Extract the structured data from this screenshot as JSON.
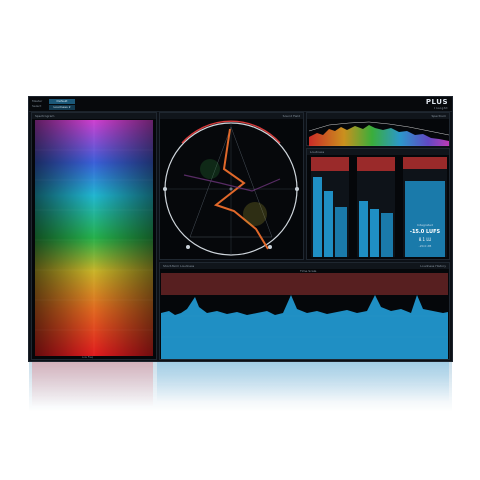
{
  "app": {
    "brand": "PLUS",
    "brand_sub": "Insight",
    "top_left_label_1": "Master",
    "top_left_label_2": "Select",
    "preset_button": "Default",
    "preset_sub": "Loudness 2"
  },
  "spectrogram": {
    "title": "Spectrogram",
    "footer": "Low Freq"
  },
  "sound_field": {
    "title": "Sound Field"
  },
  "spectrum": {
    "title": "Spectrum"
  },
  "meters": {
    "title": "Loudness",
    "readout_label": "Integrated",
    "readout_value": "-15.0 LUFS",
    "readout_value2": "8.1 LU",
    "readout_value3": "-20.0 dB"
  },
  "history": {
    "title": "Loudness History",
    "header_left": "Short-Term Loudness",
    "header_right": "Time Scale"
  },
  "colors": {
    "accent": "#1b5878",
    "meter_fill": "#1f8fc4",
    "meter_top": "#b23030"
  }
}
